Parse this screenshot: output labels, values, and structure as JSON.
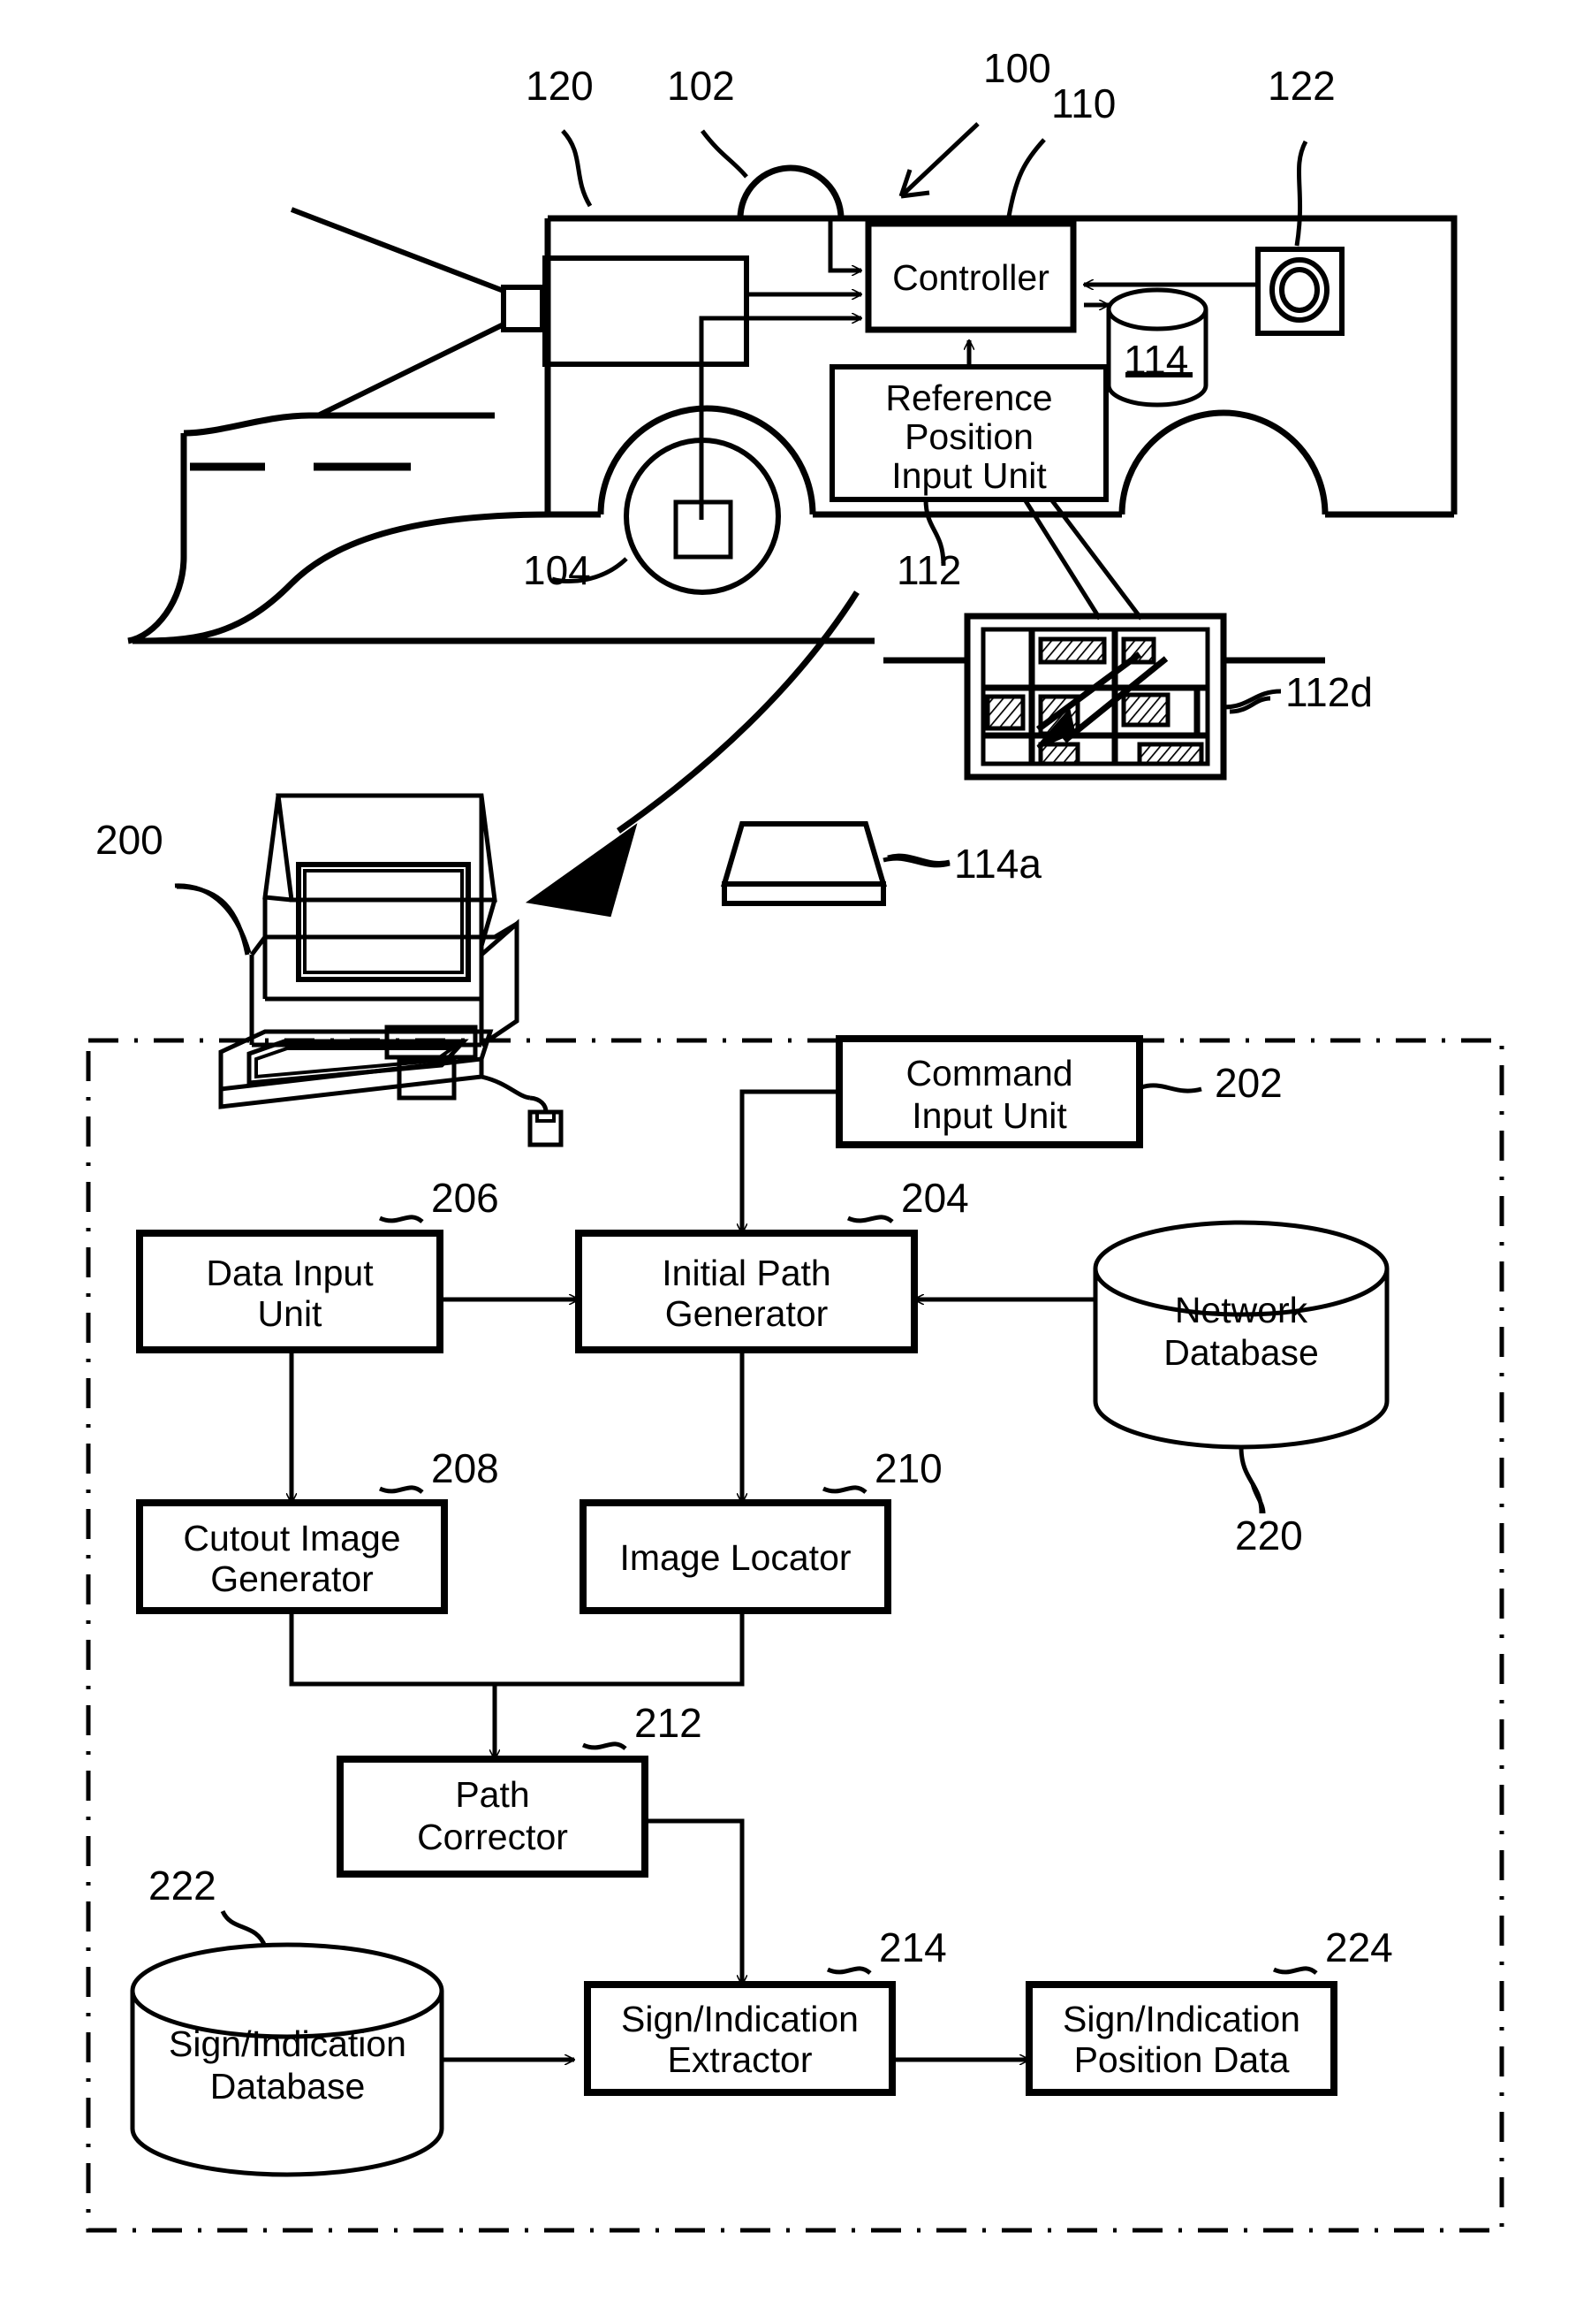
{
  "figure": {
    "type": "patent-block-diagram",
    "reference_numerals": {
      "vehicle_system": "100",
      "antenna": "102",
      "wheel_sensor": "104",
      "controller": "110",
      "reference_position_input_unit": "112",
      "map_display_panel": "112d",
      "storage": "114",
      "removable_media": "114a",
      "camera": "120",
      "sensor_122": "122",
      "workstation": "200",
      "command_input_unit": "202",
      "initial_path_generator": "204",
      "data_input_unit": "206",
      "cutout_image_generator": "208",
      "image_locator": "210",
      "path_corrector": "212",
      "sign_indication_extractor": "214",
      "network_database": "220",
      "sign_indication_database": "222",
      "sign_indication_position_data": "224"
    }
  },
  "vehicle_unit": {
    "system_ref": "100",
    "camera_ref": "120",
    "antenna_ref": "102",
    "controller_ref": "110",
    "controller_label": "Controller",
    "sensor_ref": "122",
    "storage_ref": "114",
    "reference_position_input_unit_label_line1": "Reference",
    "reference_position_input_unit_label_line2": "Position",
    "reference_position_input_unit_label_line3": "Input Unit",
    "reference_position_input_unit_ref": "112",
    "wheel_sensor_ref": "104",
    "map_panel_ref": "112d",
    "media_ref": "114a"
  },
  "workstation": {
    "ref": "200"
  },
  "blocks": [
    {
      "id": "command_input_unit",
      "ref": "202",
      "line1": "Command",
      "line2": "Input Unit"
    },
    {
      "id": "data_input_unit",
      "ref": "206",
      "line1": "Data Input",
      "line2": "Unit"
    },
    {
      "id": "initial_path_generator",
      "ref": "204",
      "line1": "Initial Path",
      "line2": "Generator"
    },
    {
      "id": "cutout_image_generator",
      "ref": "208",
      "line1": "Cutout Image",
      "line2": "Generator"
    },
    {
      "id": "image_locator",
      "ref": "210",
      "line1": "Image Locator",
      "line2": ""
    },
    {
      "id": "path_corrector",
      "ref": "212",
      "line1": "Path",
      "line2": "Corrector"
    },
    {
      "id": "sign_indication_extractor",
      "ref": "214",
      "line1": "Sign/Indication",
      "line2": "Extractor"
    },
    {
      "id": "sign_indication_position_data",
      "ref": "224",
      "line1": "Sign/Indication",
      "line2": "Position Data"
    }
  ],
  "databases": [
    {
      "id": "network_database",
      "ref": "220",
      "line1": "Network",
      "line2": "Database"
    },
    {
      "id": "sign_indication_database",
      "ref": "222",
      "line1": "Sign/Indication",
      "line2": "Database"
    }
  ],
  "colors": {
    "ink": "#000000",
    "paper": "#ffffff"
  }
}
